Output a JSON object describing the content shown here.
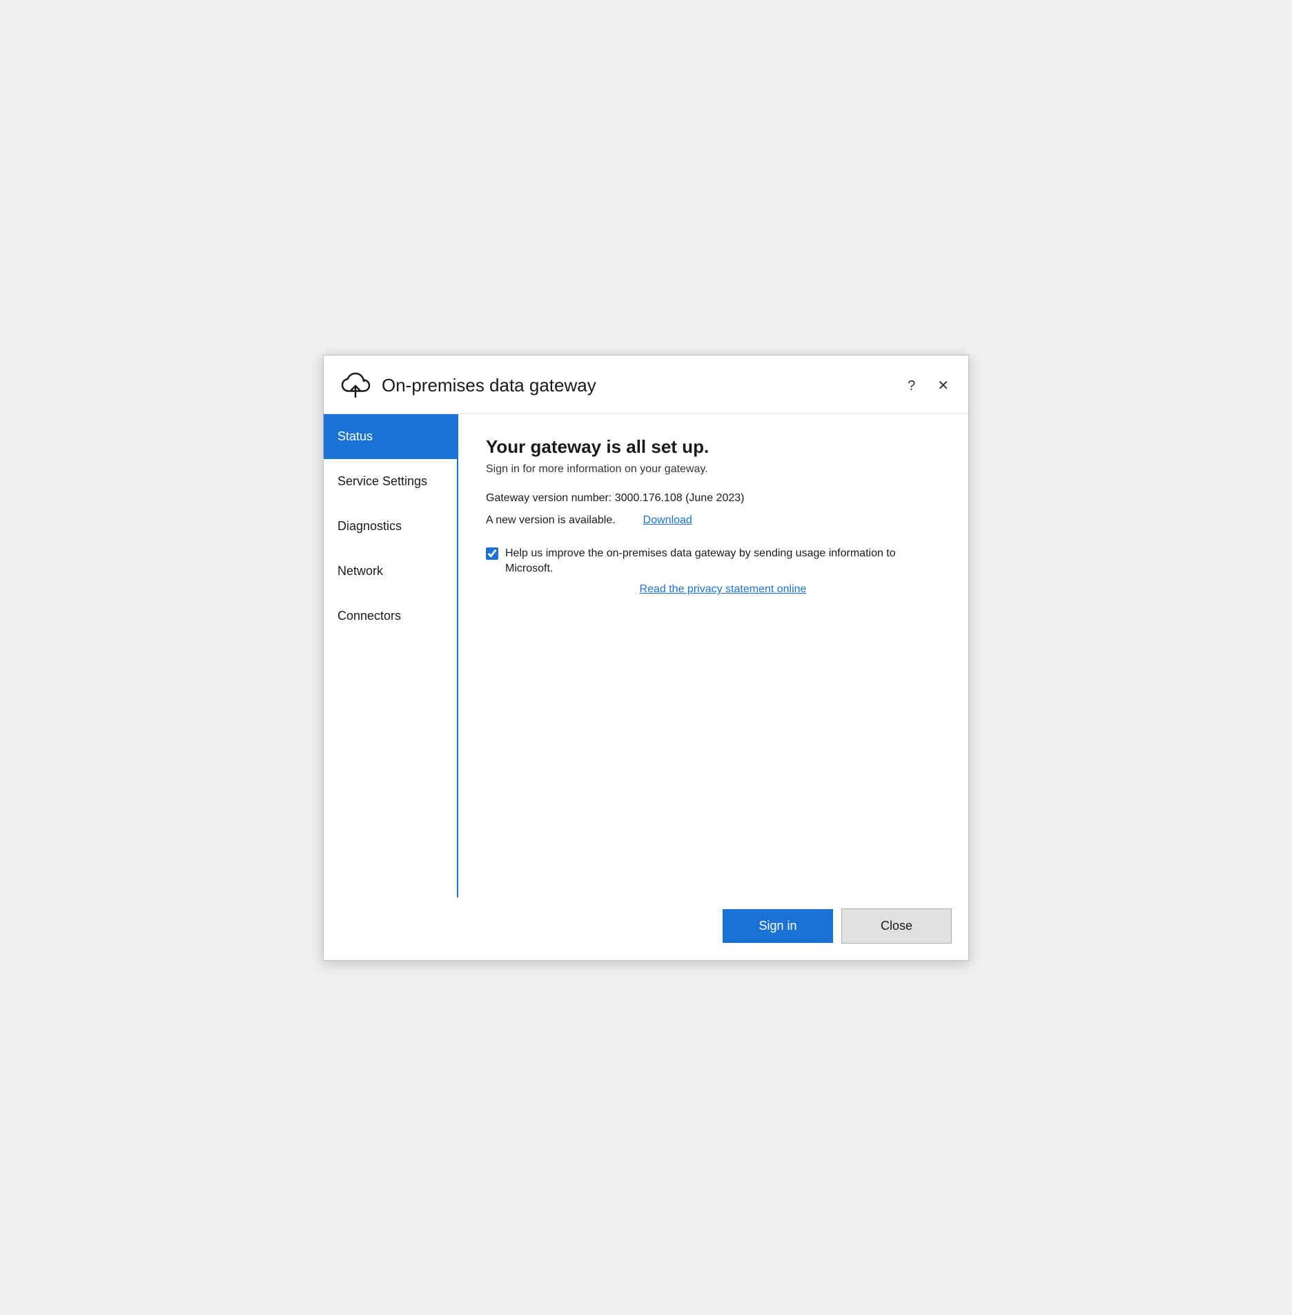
{
  "window": {
    "title": "On-premises data gateway",
    "help_label": "?",
    "close_label": "✕"
  },
  "sidebar": {
    "items": [
      {
        "id": "status",
        "label": "Status",
        "active": true
      },
      {
        "id": "service-settings",
        "label": "Service Settings",
        "active": false
      },
      {
        "id": "diagnostics",
        "label": "Diagnostics",
        "active": false
      },
      {
        "id": "network",
        "label": "Network",
        "active": false
      },
      {
        "id": "connectors",
        "label": "Connectors",
        "active": false
      }
    ]
  },
  "content": {
    "heading": "Your gateway is all set up.",
    "subtext": "Sign in for more information on your gateway.",
    "version_label": "Gateway version number: 3000.176.108 (June 2023)",
    "new_version_text": "A new version is available.",
    "download_label": "Download",
    "checkbox_label": "Help us improve the on-premises data gateway by sending usage information to Microsoft.",
    "privacy_link_label": "Read the privacy statement online"
  },
  "footer": {
    "sign_in_label": "Sign in",
    "close_label": "Close"
  },
  "colors": {
    "accent": "#1a73d4",
    "active_sidebar_bg": "#1a73d4"
  }
}
